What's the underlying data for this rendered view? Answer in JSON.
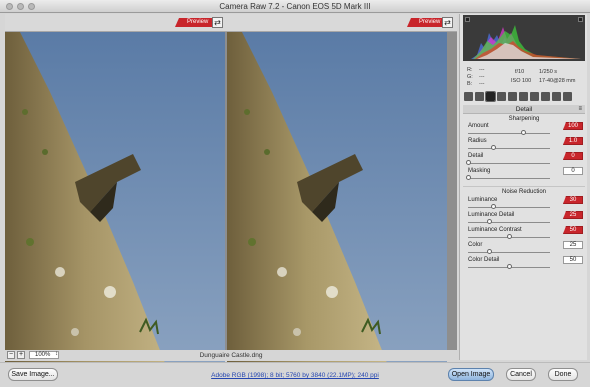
{
  "window": {
    "title": "Camera Raw 7.2  -  Canon EOS 5D Mark III"
  },
  "preview": {
    "label": "Preview",
    "swap_glyph": "⇄"
  },
  "image": {
    "filename": "Dunguaire Castle.dng",
    "zoom": "100%"
  },
  "histogram": {
    "rgb_labels": {
      "r": "R:",
      "g": "G:",
      "b": "B:"
    },
    "rgb_values": {
      "r": "---",
      "g": "---",
      "b": "---"
    },
    "exposure": {
      "aperture": "f/10",
      "shutter": "1/250 s",
      "iso": "ISO 100",
      "lens": "17-40@28 mm"
    }
  },
  "panel": {
    "title": "Detail",
    "sharpening": {
      "heading": "Sharpening",
      "controls": [
        {
          "label": "Amount",
          "value": "100",
          "highlight": true,
          "level": 0.67
        },
        {
          "label": "Radius",
          "value": "1.0",
          "highlight": true,
          "level": 0.3
        },
        {
          "label": "Detail",
          "value": "0",
          "highlight": true,
          "level": 0.0
        },
        {
          "label": "Masking",
          "value": "0",
          "highlight": false,
          "level": 0.0
        }
      ]
    },
    "noise": {
      "heading": "Noise Reduction",
      "controls": [
        {
          "label": "Luminance",
          "value": "30",
          "highlight": true,
          "level": 0.3
        },
        {
          "label": "Luminance Detail",
          "value": "25",
          "highlight": true,
          "level": 0.25
        },
        {
          "label": "Luminance Contrast",
          "value": "50",
          "highlight": true,
          "level": 0.5
        },
        {
          "label": "Color",
          "value": "25",
          "highlight": false,
          "level": 0.25
        },
        {
          "label": "Color Detail",
          "value": "50",
          "highlight": false,
          "level": 0.5
        }
      ]
    }
  },
  "footer": {
    "save_label": "Save Image...",
    "workflow_link": "Adobe RGB (1998); 8 bit; 5760 by 3840 (22.1MP); 240 ppi",
    "open_label": "Open Image",
    "cancel_label": "Cancel",
    "done_label": "Done"
  },
  "colors": {
    "accent_red": "#c8252b",
    "sky": "#6d8bb0",
    "stone": "#8c7a4e"
  }
}
